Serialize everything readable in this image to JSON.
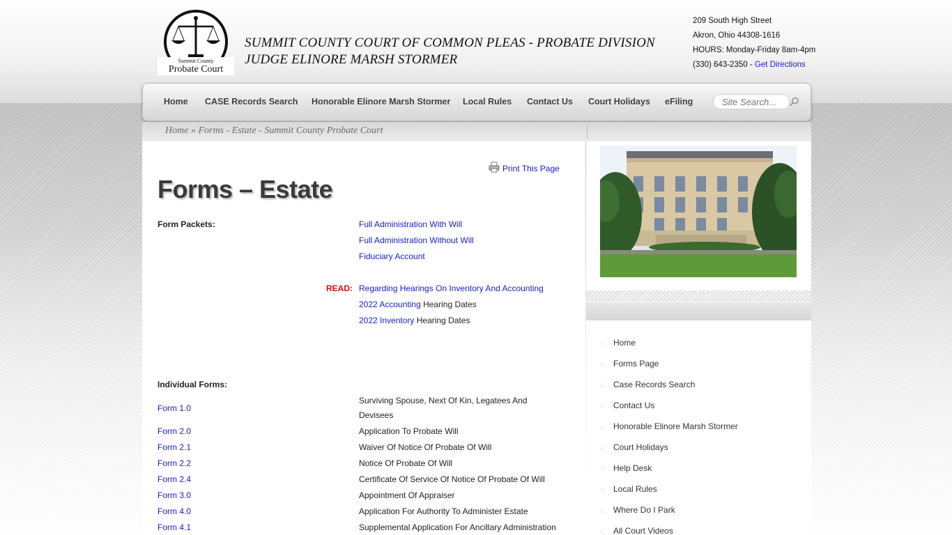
{
  "header": {
    "logo_top_text": "Summit County",
    "logo_bottom_text": "Probate Court",
    "title_line1": "SUMMIT COUNTY COURT OF COMMON PLEAS - PROBATE DIVISION",
    "title_line2": "JUDGE ELINORE MARSH STORMER",
    "address_line1": "209 South High Street",
    "address_line2": "Akron, Ohio 44308-1616",
    "hours": "HOURS: Monday-Friday 8am-4pm",
    "phone": "(330) 643-2350 -",
    "directions_link": "Get Directions"
  },
  "nav": {
    "items": [
      "Home",
      "CASE Records Search",
      "Honorable Elinore Marsh Stormer",
      "Local Rules",
      "Contact Us",
      "Court Holidays",
      "eFiling"
    ],
    "search_placeholder": "Site Search..."
  },
  "breadcrumb": {
    "home": "Home",
    "separator": " » ",
    "current": "Forms - Estate - Summit County Probate Court"
  },
  "main": {
    "print_link": "Print This Page",
    "title": "Forms – Estate",
    "form_packets_label": "Form Packets:",
    "packets": [
      "Full Administration With Will",
      "Full Administration Without Will",
      "Fiduciary Account"
    ],
    "read_label": "READ:",
    "read_link": "Regarding Hearings On Inventory And Accounting",
    "accounting_link": "2022 Accounting",
    "accounting_suffix": "Hearing Dates",
    "inventory_link": "2022 Inventory",
    "inventory_suffix": "Hearing Dates",
    "individual_forms_label": "Individual Forms:",
    "forms": [
      {
        "id": "Form 1.0",
        "desc": "Surviving Spouse, Next Of Kin, Legatees And Devisees"
      },
      {
        "id": "Form 2.0",
        "desc": "Application To Probate Will"
      },
      {
        "id": "Form 2.1",
        "desc": "Waiver Of Notice Of Probate Of Will"
      },
      {
        "id": "Form 2.2",
        "desc": "Notice Of Probate Of Will"
      },
      {
        "id": "Form 2.4",
        "desc": "Certificate Of Service Of Notice Of Probate Of Will"
      },
      {
        "id": "Form 3.0",
        "desc": "Appointment Of Appraiser"
      },
      {
        "id": "Form 4.0",
        "desc": "Application For Authority To Administer Estate"
      },
      {
        "id": "Form 4.1",
        "desc": "Supplemental Application For Ancillary Administration"
      }
    ]
  },
  "sidebar": {
    "items": [
      "Home",
      "Forms Page",
      "Case Records Search",
      "Contact Us",
      "Honorable Elinore Marsh Stormer",
      "Court Holidays",
      "Help Desk",
      "Local Rules",
      "Where Do I Park",
      "All Court Videos"
    ]
  },
  "colors": {
    "link": "#1a1ac8",
    "read_label": "#cc1111",
    "title": "#3a3a3a"
  }
}
